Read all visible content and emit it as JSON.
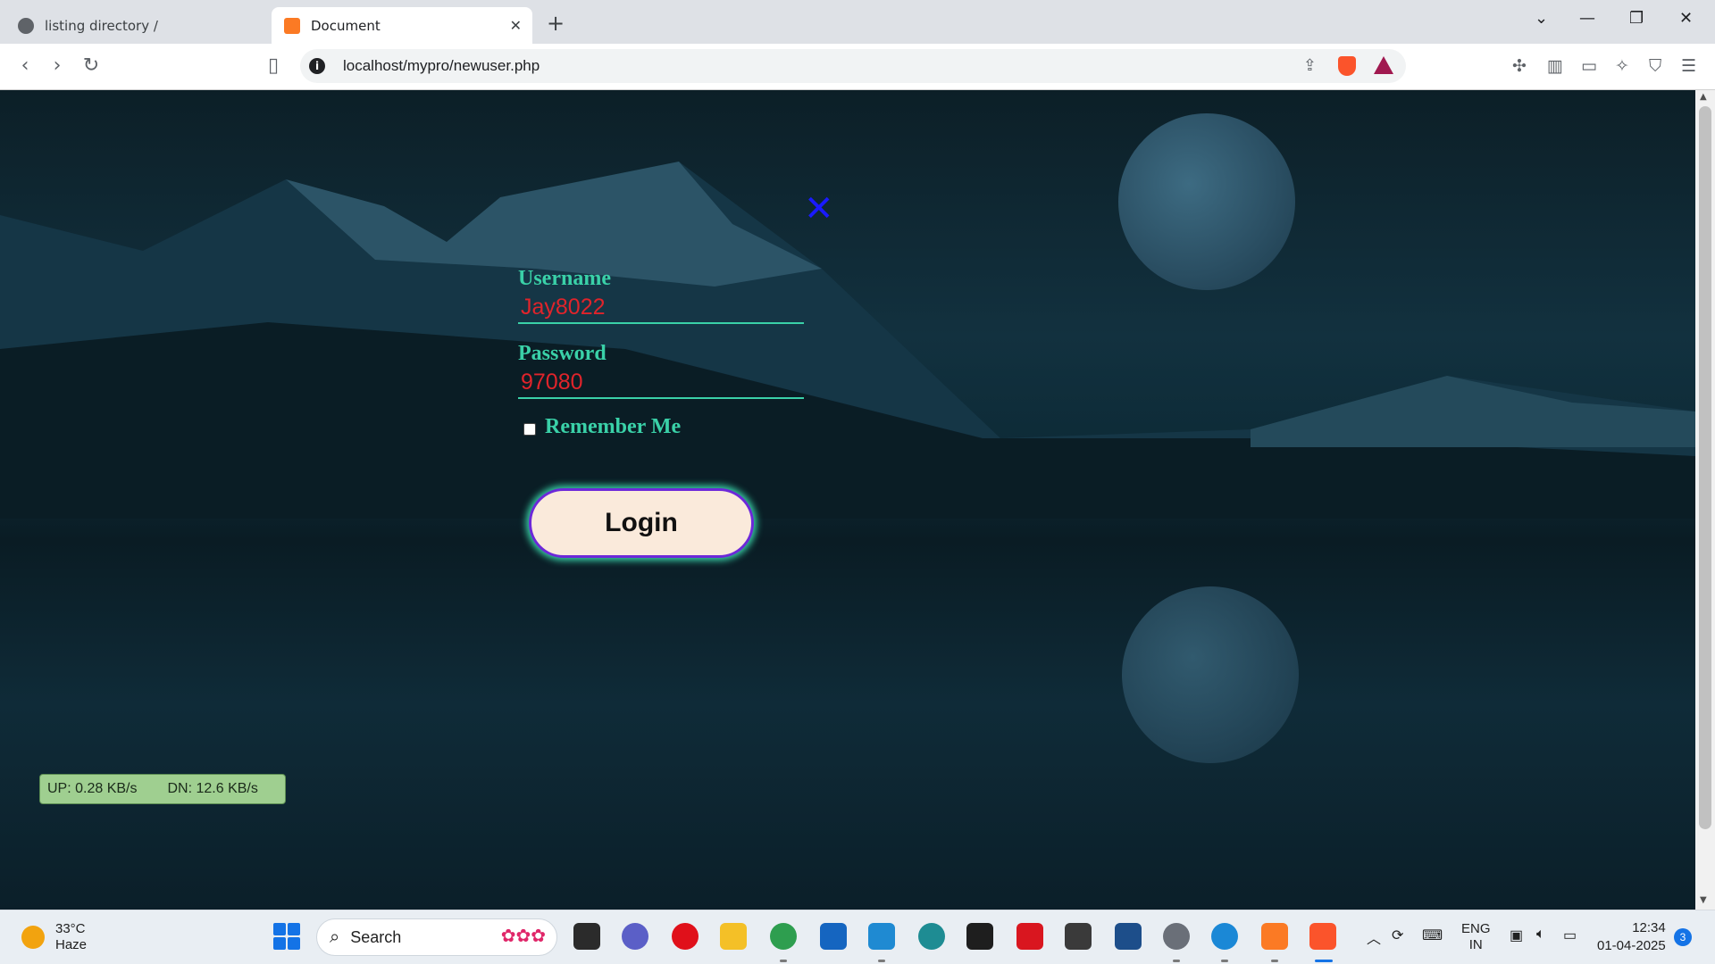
{
  "browser": {
    "tabs": [
      {
        "title": "listing directory /",
        "active": false,
        "icon": "globe-icon"
      },
      {
        "title": "Document",
        "active": true,
        "icon": "xampp-icon"
      }
    ],
    "url": "localhost/mypro/newuser.php"
  },
  "form": {
    "close_symbol": "✕",
    "username_label": "Username",
    "username_value": "Jay8022",
    "password_label": "Password",
    "password_value": "97080",
    "remember_label": "Remember Me",
    "login_label": "Login"
  },
  "netmeter": {
    "up": "UP: 0.28 KB/s",
    "dn": "DN: 12.6 KB/s"
  },
  "taskbar": {
    "temperature": "33°C",
    "weather": "Haze",
    "search_placeholder": "Search",
    "lang_top": "ENG",
    "lang_bottom": "IN",
    "time": "12:34",
    "date": "01-04-2025",
    "notifications": "3"
  },
  "colors": {
    "label": "#3ad1a8",
    "input_text": "#e0242b",
    "button_bg": "#faeadb",
    "button_border": "#6d28d9",
    "close_x": "#1a1aff"
  }
}
